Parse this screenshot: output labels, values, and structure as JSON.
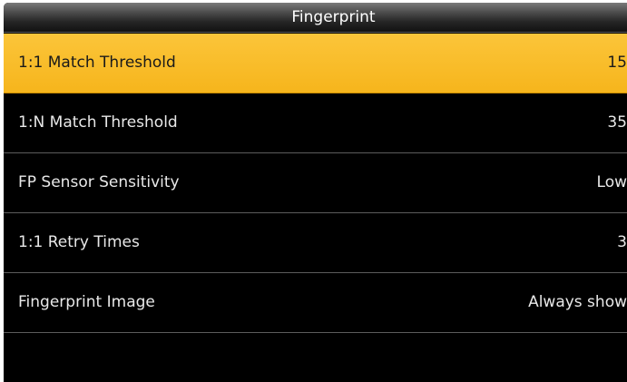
{
  "header": {
    "title": "Fingerprint"
  },
  "menu": {
    "items": [
      {
        "label": "1:1 Match Threshold",
        "value": "15",
        "selected": true
      },
      {
        "label": "1:N Match Threshold",
        "value": "35",
        "selected": false
      },
      {
        "label": "FP Sensor Sensitivity",
        "value": "Low",
        "selected": false
      },
      {
        "label": "1:1 Retry Times",
        "value": "3",
        "selected": false
      },
      {
        "label": "Fingerprint Image",
        "value": "Always show",
        "selected": false
      }
    ]
  },
  "colors": {
    "selection_highlight": "#f6b51c",
    "background": "#000000",
    "text": "#e8e8e8",
    "divider": "#5c5c5c"
  }
}
